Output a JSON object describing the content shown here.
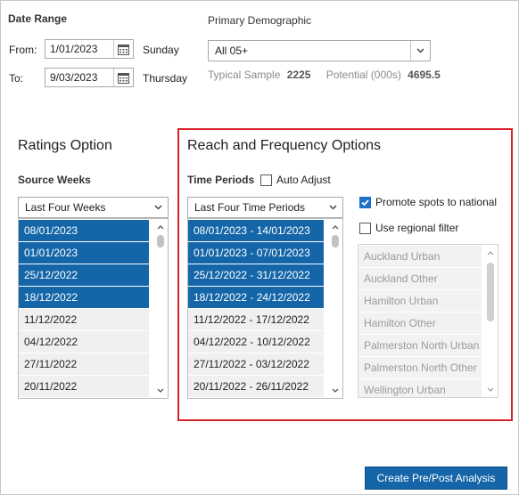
{
  "date_range": {
    "title": "Date Range",
    "from_label": "From:",
    "from_value": "1/01/2023",
    "from_day": "Sunday",
    "to_label": "To:",
    "to_value": "9/03/2023",
    "to_day": "Thursday"
  },
  "demographic": {
    "title": "Primary Demographic",
    "selected": "All 05+",
    "typical_sample_label": "Typical Sample",
    "typical_sample_value": "2225",
    "potential_label": "Potential (000s)",
    "potential_value": "4695.5"
  },
  "ratings": {
    "title": "Ratings Option",
    "source_weeks_label": "Source Weeks",
    "selected": "Last Four Weeks",
    "weeks": [
      {
        "label": "08/01/2023",
        "selected": true
      },
      {
        "label": "01/01/2023",
        "selected": true
      },
      {
        "label": "25/12/2022",
        "selected": true
      },
      {
        "label": "18/12/2022",
        "selected": true
      },
      {
        "label": "11/12/2022",
        "selected": false
      },
      {
        "label": "04/12/2022",
        "selected": false
      },
      {
        "label": "27/11/2022",
        "selected": false
      },
      {
        "label": "20/11/2022",
        "selected": false
      }
    ]
  },
  "reach": {
    "title": "Reach and Frequency Options",
    "time_periods_label": "Time Periods",
    "auto_adjust_label": "Auto Adjust",
    "auto_adjust_checked": false,
    "selected": "Last Four Time Periods",
    "periods": [
      {
        "label": "08/01/2023 - 14/01/2023",
        "selected": true
      },
      {
        "label": "01/01/2023 - 07/01/2023",
        "selected": true
      },
      {
        "label": "25/12/2022 - 31/12/2022",
        "selected": true
      },
      {
        "label": "18/12/2022 - 24/12/2022",
        "selected": true
      },
      {
        "label": "11/12/2022 - 17/12/2022",
        "selected": false
      },
      {
        "label": "04/12/2022 - 10/12/2022",
        "selected": false
      },
      {
        "label": "27/11/2022 - 03/12/2022",
        "selected": false
      },
      {
        "label": "20/11/2022 - 26/11/2022",
        "selected": false
      }
    ],
    "promote_label": "Promote spots to national",
    "promote_checked": true,
    "regional_label": "Use regional filter",
    "regional_checked": false,
    "regions": [
      "Auckland Urban",
      "Auckland Other",
      "Hamilton Urban",
      "Hamilton Other",
      "Palmerston North Urban",
      "Palmerston North Other",
      "Wellington Urban"
    ]
  },
  "actions": {
    "analysis_button": "Create Pre/Post Analysis"
  },
  "colors": {
    "selection": "#1566a8",
    "highlight_border": "#d8232a",
    "checkbox_checked": "#1a73c9"
  }
}
